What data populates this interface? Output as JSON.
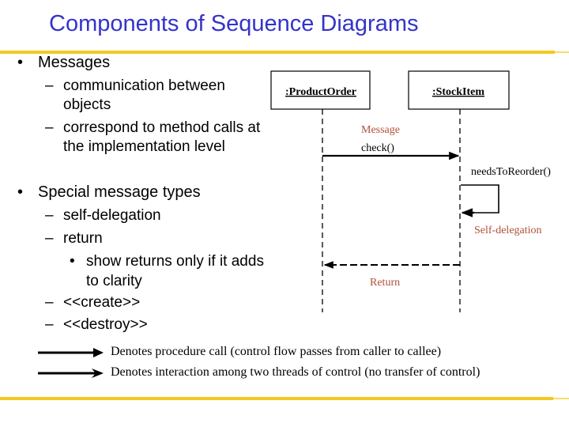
{
  "title": "Components of Sequence Diagrams",
  "bullets": {
    "messages": {
      "label": "Messages",
      "subitems": [
        {
          "line1": "communication between",
          "line2": "objects"
        },
        {
          "line1": "correspond to method calls at",
          "line2": "the implementation level"
        }
      ]
    },
    "special": {
      "label": "Special message types",
      "subitems": [
        {
          "label": "self-delegation"
        },
        {
          "label": "return",
          "subbullet": {
            "line1": "show returns only if it adds",
            "line2": "to clarity"
          }
        },
        {
          "label": "<<create>>"
        },
        {
          "label": "<<destroy>>"
        }
      ]
    },
    "bullet_glyph": "•",
    "dash_glyph": "–"
  },
  "diagram": {
    "objects": [
      {
        "name": ":ProductOrder"
      },
      {
        "name": ":StockItem"
      }
    ],
    "messages": [
      {
        "annotation": "Message",
        "label": "check()",
        "from": ":ProductOrder",
        "to": ":StockItem",
        "kind": "call"
      },
      {
        "annotation": "Self-delegation",
        "label": "needsToReorder()",
        "from": ":StockItem",
        "to": ":StockItem",
        "kind": "self"
      },
      {
        "annotation": "Return",
        "label": "",
        "from": ":StockItem",
        "to": ":ProductOrder",
        "kind": "return"
      }
    ],
    "colors": {
      "annotation": "#b0503a",
      "title": "#3333cc",
      "rule": "#f5c81f"
    }
  },
  "legend": [
    {
      "arrow": "procedure-call",
      "text": "Denotes procedure call (control flow passes from caller to callee)"
    },
    {
      "arrow": "async-interaction",
      "text": "Denotes interaction among two threads of control (no transfer of control)"
    }
  ]
}
